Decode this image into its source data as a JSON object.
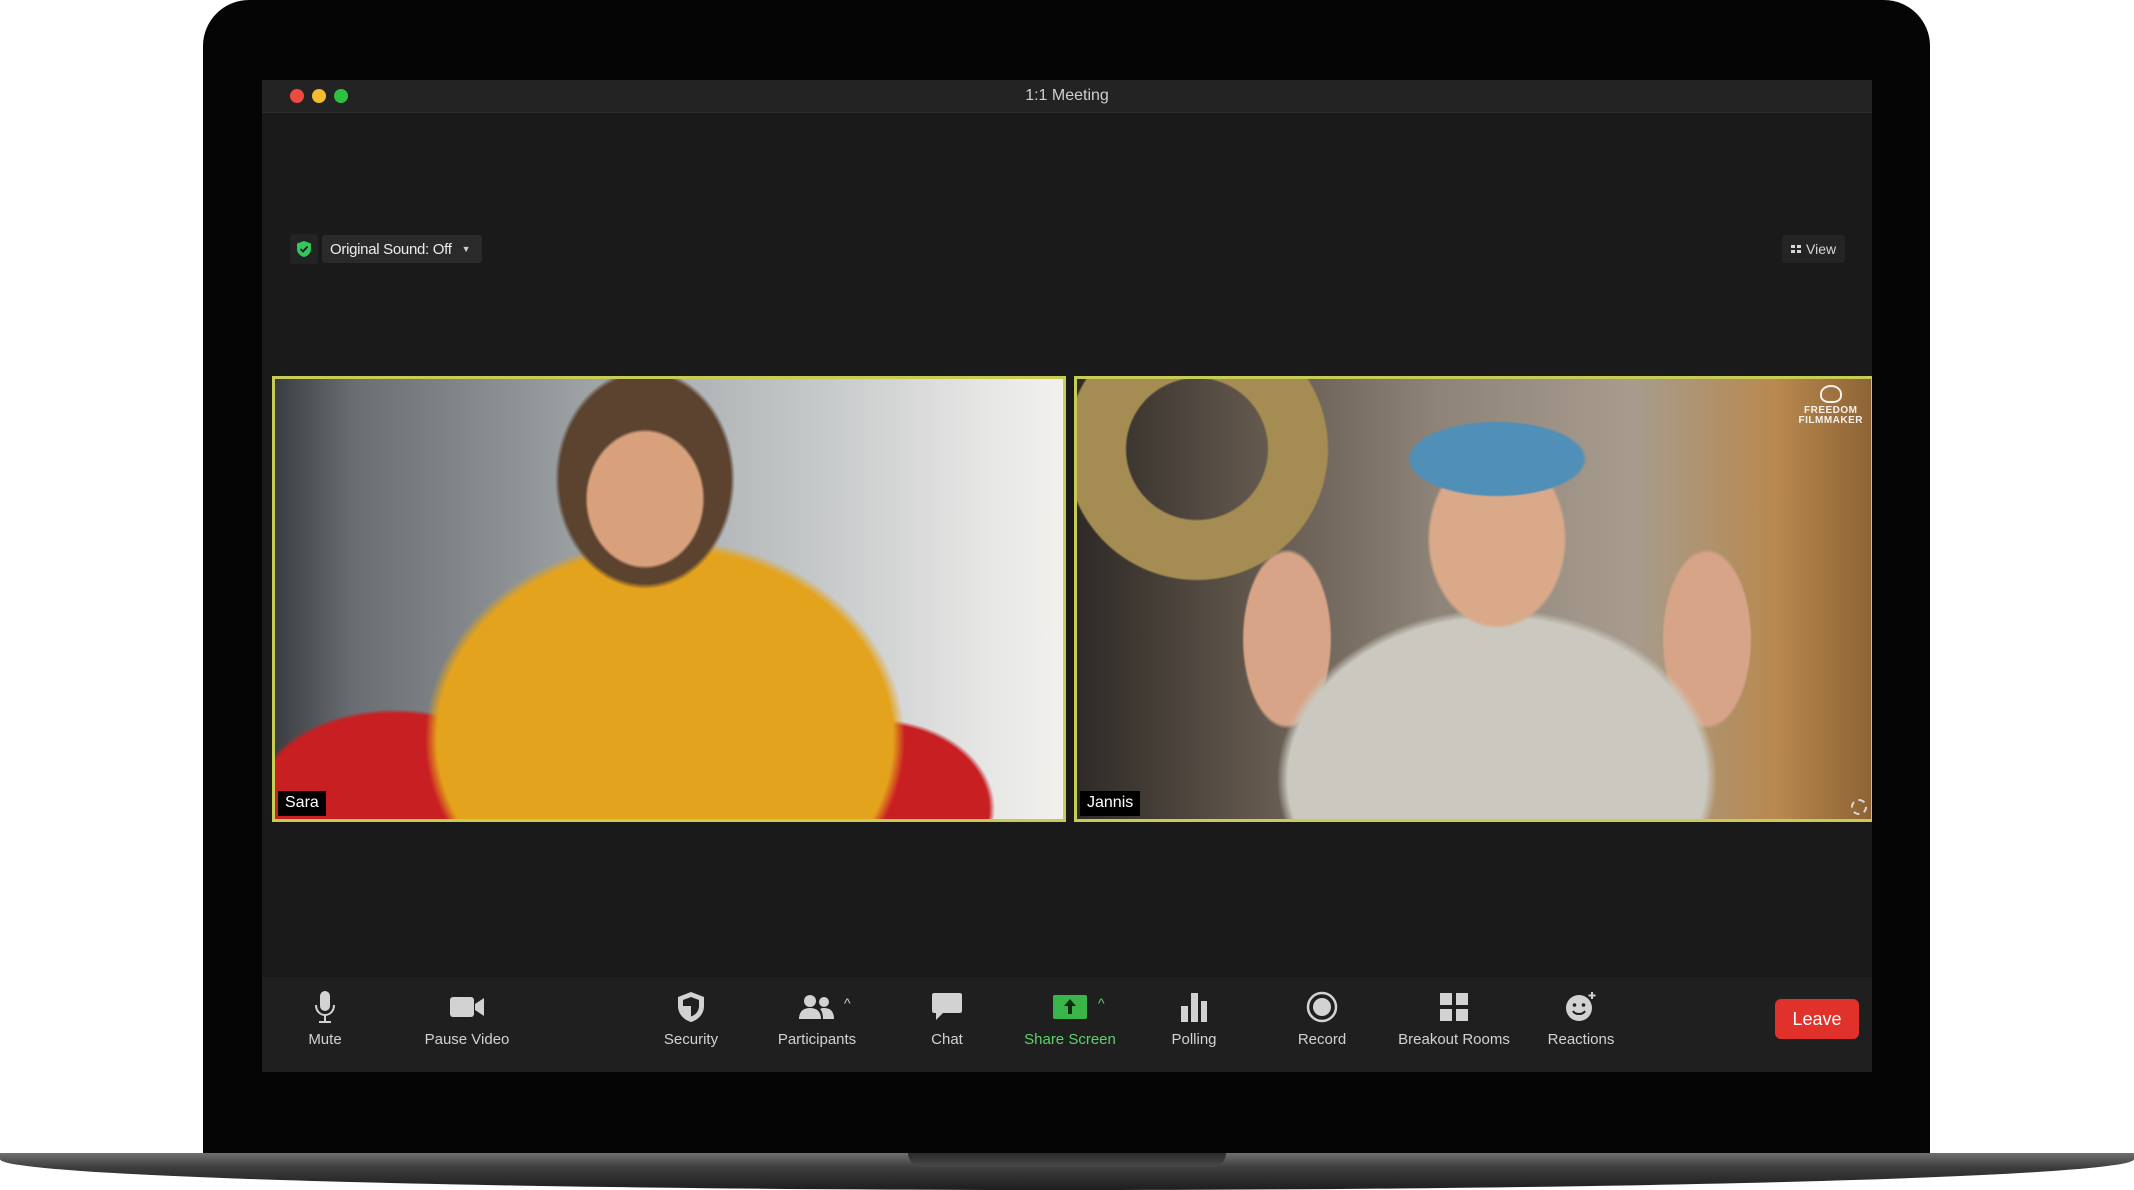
{
  "window": {
    "title": "1:1 Meeting"
  },
  "top_controls": {
    "original_sound_label": "Original Sound: Off",
    "view_label": "View"
  },
  "participants": [
    {
      "name": "Sara"
    },
    {
      "name": "Jannis",
      "watermark_line1": "FREEDOM",
      "watermark_line2": "FILMMAKER"
    }
  ],
  "toolbar": {
    "mute": "Mute",
    "pause_video": "Pause Video",
    "security": "Security",
    "participants": "Participants",
    "chat": "Chat",
    "share_screen": "Share Screen",
    "polling": "Polling",
    "record": "Record",
    "breakout_rooms": "Breakout Rooms",
    "reactions": "Reactions",
    "leave": "Leave"
  },
  "colors": {
    "active_speaker_border": "#c7cc55",
    "share_screen_green": "#5bd36a",
    "leave_red": "#e0312b",
    "encryption_shield_green": "#35c759"
  },
  "icons": {
    "mute": "microphone-icon",
    "pause_video": "video-camera-icon",
    "security": "shield-icon",
    "participants": "people-icon",
    "chat": "chat-bubble-icon",
    "share_screen": "share-screen-icon",
    "polling": "bar-chart-icon",
    "record": "record-icon",
    "breakout_rooms": "grid-icon",
    "reactions": "smiley-icon"
  }
}
